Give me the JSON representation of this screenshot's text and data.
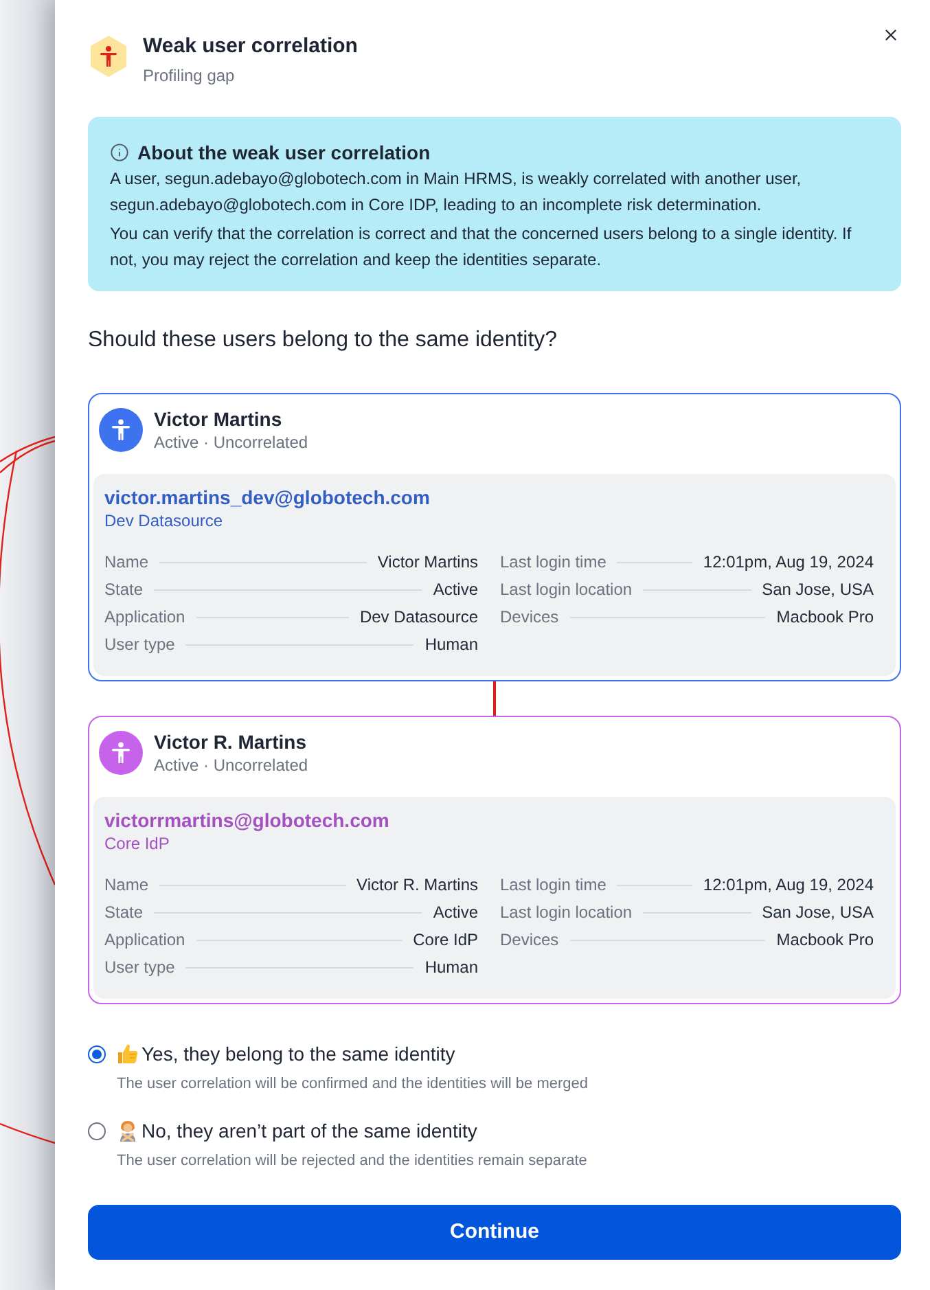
{
  "header": {
    "title": "Weak user correlation",
    "subtitle": "Profiling gap"
  },
  "info": {
    "title": "About the weak user correlation",
    "paragraphs": [
      "A user, segun.adebayo@globotech.com in Main HRMS, is weakly correlated with another user, segun.adebayo@globotech.com in Core IDP, leading to an incomplete risk determination.",
      "You can verify that the correlation is correct and that the concerned users belong to a single identity. If not, you may reject the correlation and keep the identities separate."
    ]
  },
  "question": "Should these users belong to the same identity?",
  "users": [
    {
      "name": "Victor Martins",
      "status": "Active · Uncorrelated",
      "color": "#3d73ee",
      "email": "victor.martins_dev@globotech.com",
      "source": "Dev Datasource",
      "detail_columns": [
        [
          {
            "label": "Name",
            "value": "Victor Martins"
          },
          {
            "label": "State",
            "value": "Active"
          },
          {
            "label": "Application",
            "value": "Dev Datasource"
          },
          {
            "label": "User type",
            "value": "Human"
          }
        ],
        [
          {
            "label": "Last login time",
            "value": "12:01pm, Aug 19, 2024"
          },
          {
            "label": "Last login location",
            "value": "San Jose, USA"
          },
          {
            "label": "Devices",
            "value": "Macbook Pro"
          }
        ]
      ]
    },
    {
      "name": "Victor R. Martins",
      "status": "Active · Uncorrelated",
      "color": "#c762ea",
      "email": "victorrmartins@globotech.com",
      "source": "Core IdP",
      "detail_columns": [
        [
          {
            "label": "Name",
            "value": "Victor R. Martins"
          },
          {
            "label": "State",
            "value": "Active"
          },
          {
            "label": "Application",
            "value": "Core IdP"
          },
          {
            "label": "User type",
            "value": "Human"
          }
        ],
        [
          {
            "label": "Last login time",
            "value": "12:01pm, Aug 19, 2024"
          },
          {
            "label": "Last login location",
            "value": "San Jose, USA"
          },
          {
            "label": "Devices",
            "value": "Macbook Pro"
          }
        ]
      ]
    }
  ],
  "options": [
    {
      "kind": "confirm",
      "label": "Yes, they belong to the same identity",
      "description": "The user correlation will be confirmed and the identities will be merged",
      "selected": true
    },
    {
      "kind": "reject",
      "label": "No, they aren’t part of the same identity",
      "description": "The user correlation will be rejected and the identities remain separate",
      "selected": false
    }
  ],
  "button": "Continue"
}
